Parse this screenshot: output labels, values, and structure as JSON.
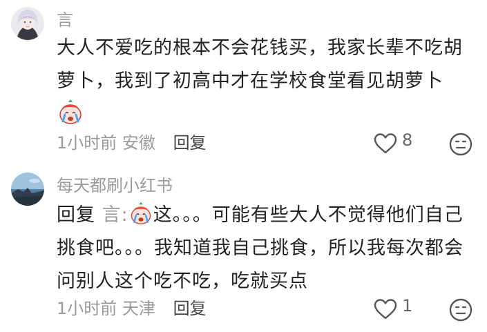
{
  "comments": [
    {
      "username": "言",
      "text": "大人不爱吃的根本不会花钱买，我家长辈不吃胡萝卜，我到了初高中才在学校食堂看见胡萝卜",
      "trailing_emoji": "crying-face-emoji",
      "time": "1小时前",
      "location": "安徽",
      "reply_label": "回复",
      "likes": "8"
    },
    {
      "username": "每天都刷小红书",
      "reply_prefix": "回复",
      "reply_target": "言:",
      "inline_emoji": "crying-face-emoji",
      "text": "这。。。可能有些大人不觉得他们自己挑食吧。。。我知道我自己挑食，所以我每次都会问别人这个吃不吃，吃就买点",
      "time": "1小时前",
      "location": "天津",
      "reply_label": "回复",
      "likes": "1"
    }
  ],
  "icons": {
    "like": "heart-outline-icon",
    "dislike": "meh-face-icon"
  },
  "colors": {
    "text": "#222222",
    "secondary": "#9a9a9a",
    "icon": "#555555"
  }
}
